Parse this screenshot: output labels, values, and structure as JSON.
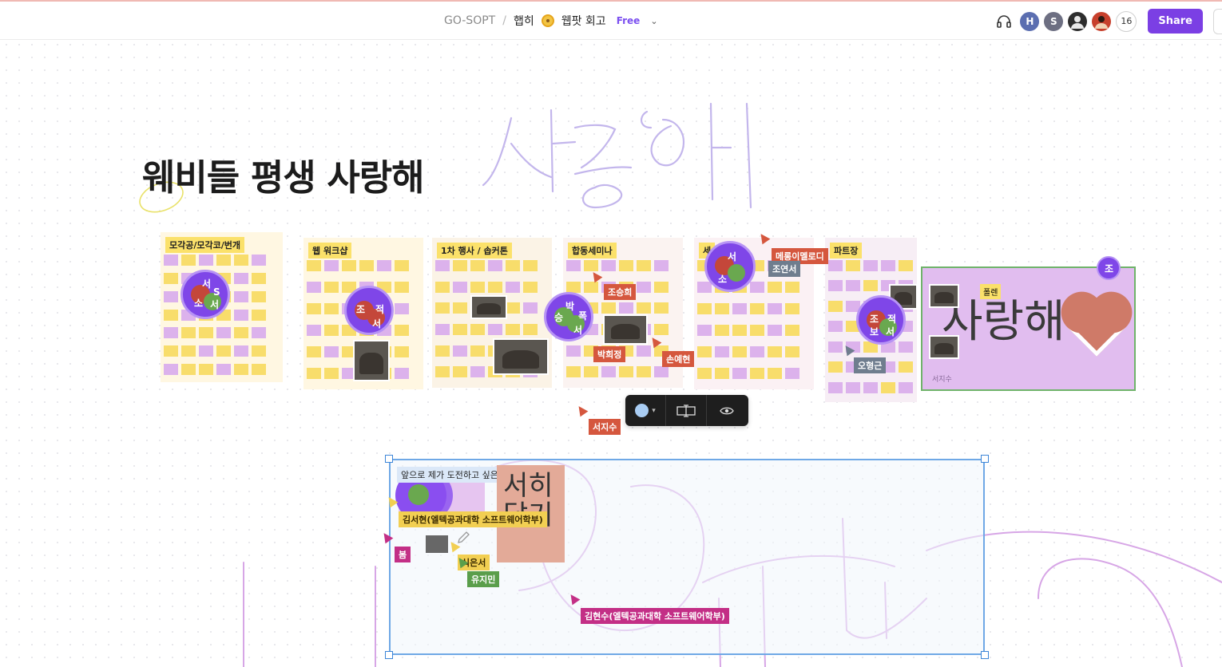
{
  "header": {
    "team": "GO-SOPT",
    "separator": "/",
    "board_prefix": "햅히",
    "board_suffix": "웹팟 회고",
    "plan_badge": "Free",
    "avatars": [
      {
        "initial": "H",
        "color": "#5b6eb0"
      },
      {
        "initial": "S",
        "color": "#6d6f82"
      },
      {
        "initial": "",
        "color": "#2d2d2d"
      },
      {
        "initial": "",
        "color": "#c7402c"
      }
    ],
    "collaborator_count": "16",
    "share_label": "Share"
  },
  "canvas": {
    "title": "웨비들 평생 사랑해",
    "frames": [
      {
        "label": "모각공/모각코/번개"
      },
      {
        "label": "웹 워크샵"
      },
      {
        "label": "1차 행사 / 솝커톤"
      },
      {
        "label": "합동세미나"
      },
      {
        "label": "세"
      },
      {
        "label": "파트장"
      }
    ],
    "name_tags": [
      {
        "text": "조승희"
      },
      {
        "text": "박희정"
      },
      {
        "text": "손예현"
      },
      {
        "text": "메롱이멜로디"
      },
      {
        "text": "조연서"
      },
      {
        "text": "오형근"
      },
      {
        "text": "서지수"
      },
      {
        "text": "김서현(엘텍공과대학 소프트웨어학부)"
      },
      {
        "text": "봄"
      },
      {
        "text": "식은서"
      },
      {
        "text": "유지민"
      },
      {
        "text": "김현수(엘텍공과대학 소프트웨어학부)"
      }
    ],
    "big_card": {
      "text": "사랑해",
      "sticky": "폴렌",
      "footer": "서지수",
      "avatar": "조"
    },
    "selected_frame": {
      "label": "앞으로 제가 도전하고 싶은것",
      "card_text_1": "서히",
      "card_text_2": "닮기"
    },
    "cluster_letters": {
      "c1": [
        "서",
        "S",
        "소",
        "서"
      ],
      "c2": [
        "조",
        "적",
        "서"
      ],
      "c3": [
        "승",
        "박",
        "폭",
        "서"
      ],
      "c4": [
        "서",
        "소"
      ],
      "c5": [
        "조",
        "적",
        "보",
        "서"
      ]
    },
    "doodle_text": "사랑해"
  },
  "colors": {
    "accent": "#7b3fe4",
    "selection": "#6fa8e6"
  }
}
